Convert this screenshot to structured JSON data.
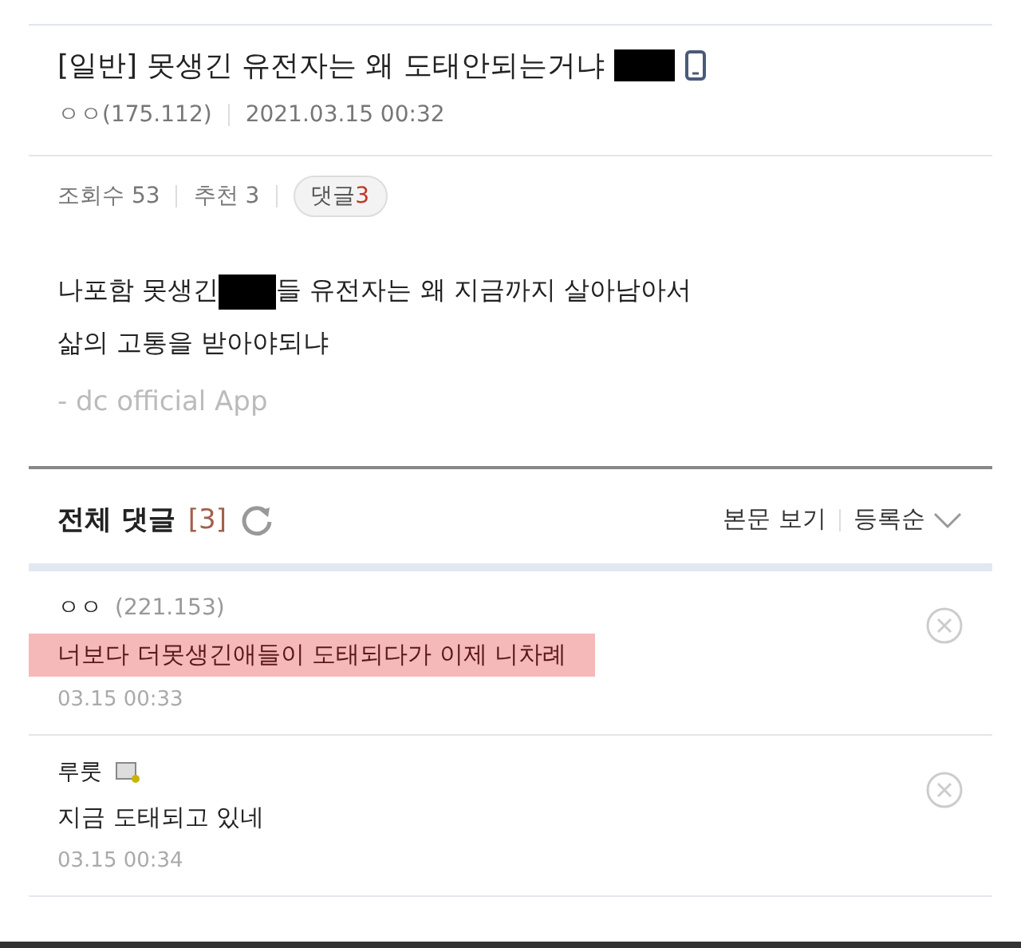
{
  "post": {
    "title": [
      {
        "kind": "text",
        "text": "[일반] 못생긴 유전자는 왜 도태안되는거냐"
      },
      {
        "kind": "redacted"
      }
    ],
    "mobile": true,
    "author": "ㅇㅇ(175.112)",
    "date": "2021.03.15 00:32",
    "views": "조회수 53",
    "recommends": "추천 3",
    "comment_label": "댓글",
    "comment_count": "3",
    "body": [
      [
        {
          "kind": "text",
          "text": "나포함 못생긴"
        },
        {
          "kind": "redacted"
        },
        {
          "kind": "text",
          "text": "들 유전자는 왜 지금까지 살아남아서"
        }
      ],
      [
        {
          "kind": "text",
          "text": "삶의 고통을 받아야되냐"
        }
      ]
    ],
    "signature": "- dc official App"
  },
  "comments_header": {
    "title": "전체 댓글",
    "count": "[3]",
    "view_body": "본문 보기",
    "sort": "등록순"
  },
  "comments": [
    {
      "name": "ㅇㅇ",
      "ip": "(221.153)",
      "fixed_nick": false,
      "text": "너보다 더못생긴애들이 도태되다가 이제 니차례",
      "highlighted": true,
      "date": "03.15 00:33"
    },
    {
      "name": "루룻",
      "fixed_nick": true,
      "text": "지금 도태되고 있네",
      "highlighted": false,
      "date": "03.15 00:34"
    }
  ]
}
